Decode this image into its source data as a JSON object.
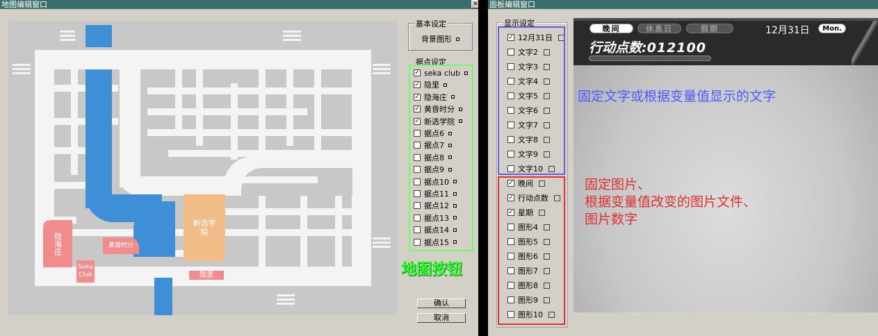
{
  "map_window": {
    "title": "地图编辑窗口",
    "basic_group": {
      "legend": "基本设定",
      "bg_label": "背景图形"
    },
    "points_group": {
      "legend": "据点设定",
      "items": [
        {
          "label": "seka club",
          "checked": true
        },
        {
          "label": "隐里",
          "checked": true
        },
        {
          "label": "隐海庄",
          "checked": true
        },
        {
          "label": "黄昏时分",
          "checked": true
        },
        {
          "label": "新选学院",
          "checked": true
        },
        {
          "label": "据点6",
          "checked": false
        },
        {
          "label": "据点7",
          "checked": false
        },
        {
          "label": "据点8",
          "checked": false
        },
        {
          "label": "据点9",
          "checked": false
        },
        {
          "label": "据点10",
          "checked": false
        },
        {
          "label": "据点11",
          "checked": false
        },
        {
          "label": "据点12",
          "checked": false
        },
        {
          "label": "据点13",
          "checked": false
        },
        {
          "label": "据点14",
          "checked": false
        },
        {
          "label": "据点15",
          "checked": false
        }
      ]
    },
    "ok_label": "确认",
    "cancel_label": "取消",
    "map_labels": {
      "yinhaizhuang": "隐海庄",
      "sekaclub": "Seka Club",
      "huanghun": "黄昏时分",
      "xinxuan": "新选学院",
      "yinli": "隐里"
    },
    "annotation": "地图按钮"
  },
  "panel_window": {
    "title": "面板编辑窗口",
    "display_group": {
      "legend": "显示设定",
      "text_items": [
        {
          "label": "12月31日",
          "checked": true
        },
        {
          "label": "文字2",
          "checked": false
        },
        {
          "label": "文字3",
          "checked": false
        },
        {
          "label": "文字4",
          "checked": false
        },
        {
          "label": "文字5",
          "checked": false
        },
        {
          "label": "文字6",
          "checked": false
        },
        {
          "label": "文字7",
          "checked": false
        },
        {
          "label": "文字8",
          "checked": false
        },
        {
          "label": "文字9",
          "checked": false
        },
        {
          "label": "文字10",
          "checked": false
        }
      ],
      "image_items": [
        {
          "label": "晚间",
          "checked": true
        },
        {
          "label": "行动点数",
          "checked": true
        },
        {
          "label": "星期",
          "checked": true
        },
        {
          "label": "图形4",
          "checked": false
        },
        {
          "label": "图形5",
          "checked": false
        },
        {
          "label": "图形6",
          "checked": false
        },
        {
          "label": "图形7",
          "checked": false
        },
        {
          "label": "图形8",
          "checked": false
        },
        {
          "label": "图形9",
          "checked": false
        },
        {
          "label": "图形10",
          "checked": false
        }
      ]
    },
    "preview": {
      "tab_evening": "晚间",
      "tab_holiday": "休息日",
      "tab_vacation": "假期",
      "date": "12月31日",
      "weekday": "Mon.",
      "action_label": "行动点数",
      "colon": ":",
      "action_value": "012100"
    },
    "annotation_text": "固定文字或根据变量值显示的文字",
    "annotation_image": [
      "固定图片、",
      "根据变量值改变的图片文件、",
      "图片数字"
    ]
  },
  "colors": {
    "titlebar": "#3a6e6a",
    "window_bg": "#d4d0c8",
    "map_road": "#f4f4f4",
    "map_water": "#3f8fd6",
    "label_pink": "#f08c8c",
    "label_orange": "#f0bc88",
    "highlight_green": "#66ff66",
    "highlight_blue": "#6060e0",
    "highlight_red": "#e03030",
    "annotation_green": "#33ff33"
  }
}
